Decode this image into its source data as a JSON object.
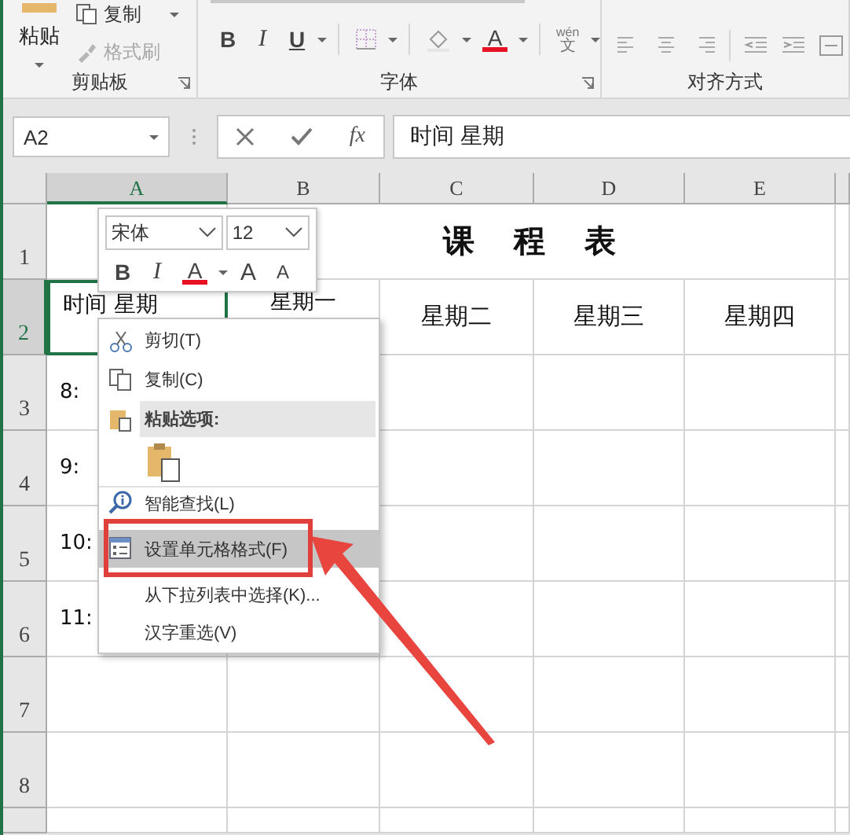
{
  "ribbon": {
    "groups": [
      {
        "label": "剪贴板",
        "buttons": [
          {
            "kind": "paste",
            "label": "粘贴",
            "disabled": false
          },
          {
            "kind": "copy",
            "label": "复制",
            "disabled": false
          },
          {
            "kind": "format-painter",
            "label": "格式刷",
            "disabled": true
          }
        ]
      },
      {
        "label": "字体",
        "buttons": [
          {
            "kind": "bold",
            "label": "B"
          },
          {
            "kind": "italic",
            "label": "I"
          },
          {
            "kind": "underline",
            "label": "U"
          },
          {
            "kind": "borders"
          },
          {
            "kind": "fill-color"
          },
          {
            "kind": "font-color",
            "label": "A"
          },
          {
            "kind": "phonetic",
            "label": "wén",
            "sub": "文"
          }
        ]
      },
      {
        "label": "对齐方式",
        "buttons": [
          {
            "kind": "align-left"
          },
          {
            "kind": "align-center"
          },
          {
            "kind": "align-right"
          },
          {
            "kind": "indent-decrease"
          },
          {
            "kind": "indent-increase"
          },
          {
            "kind": "merge"
          }
        ]
      }
    ]
  },
  "formula_bar": {
    "name_box": "A2",
    "insert_function": "fx",
    "formula": "时间 星期"
  },
  "sheet": {
    "columns": [
      {
        "label": "A",
        "selected": true
      },
      {
        "label": "B",
        "selected": false
      },
      {
        "label": "C",
        "selected": false
      },
      {
        "label": "D",
        "selected": false
      },
      {
        "label": "E",
        "selected": false
      }
    ],
    "rows": [
      {
        "label": "1",
        "selected": false,
        "title": "课 程 表"
      },
      {
        "label": "2",
        "selected": true,
        "cells": [
          {
            "text": "时间 星期",
            "selected": true
          },
          {
            "text": "星期一",
            "selected": false
          },
          {
            "text": "星期二",
            "selected": false
          },
          {
            "text": "星期三",
            "selected": false
          },
          {
            "text": "星期四",
            "selected": false
          }
        ]
      },
      {
        "label": "3",
        "selected": false,
        "cells": [
          {
            "text": "8:",
            "selected": false
          }
        ]
      },
      {
        "label": "4",
        "selected": false,
        "cells": [
          {
            "text": "9:",
            "selected": false
          }
        ]
      },
      {
        "label": "5",
        "selected": false,
        "cells": [
          {
            "text": "10:",
            "selected": false
          }
        ]
      },
      {
        "label": "6",
        "selected": false,
        "cells": [
          {
            "text": "11:",
            "selected": false
          }
        ]
      },
      {
        "label": "7",
        "selected": false
      },
      {
        "label": "8",
        "selected": false
      }
    ]
  },
  "mini_toolbar": {
    "font": "宋体",
    "size": "12",
    "buttons": [
      {
        "kind": "bold",
        "label": "B"
      },
      {
        "kind": "italic",
        "label": "I"
      },
      {
        "kind": "font-color",
        "label": "A"
      },
      {
        "kind": "grow",
        "label": "A"
      },
      {
        "kind": "shrink",
        "label": "A"
      }
    ]
  },
  "context_menu": {
    "items": [
      {
        "kind": "cut",
        "label": "剪切(T)",
        "selected": false
      },
      {
        "kind": "copy",
        "label": "复制(C)",
        "selected": false
      },
      {
        "kind": "paste-header",
        "label": "粘贴选项:",
        "selected": false
      },
      {
        "kind": "paste-options",
        "selected": false
      },
      {
        "kind": "smart-lookup",
        "label": "智能查找(L)",
        "selected": false
      },
      {
        "kind": "format-cells",
        "label": "设置单元格格式(F)",
        "selected": true
      },
      {
        "kind": "plain",
        "label": "从下拉列表中选择(K)...",
        "selected": false
      },
      {
        "kind": "plain",
        "label": "汉字重选(V)",
        "selected": false
      }
    ]
  },
  "annotation": {
    "highlight_box": true,
    "arrow": true
  }
}
